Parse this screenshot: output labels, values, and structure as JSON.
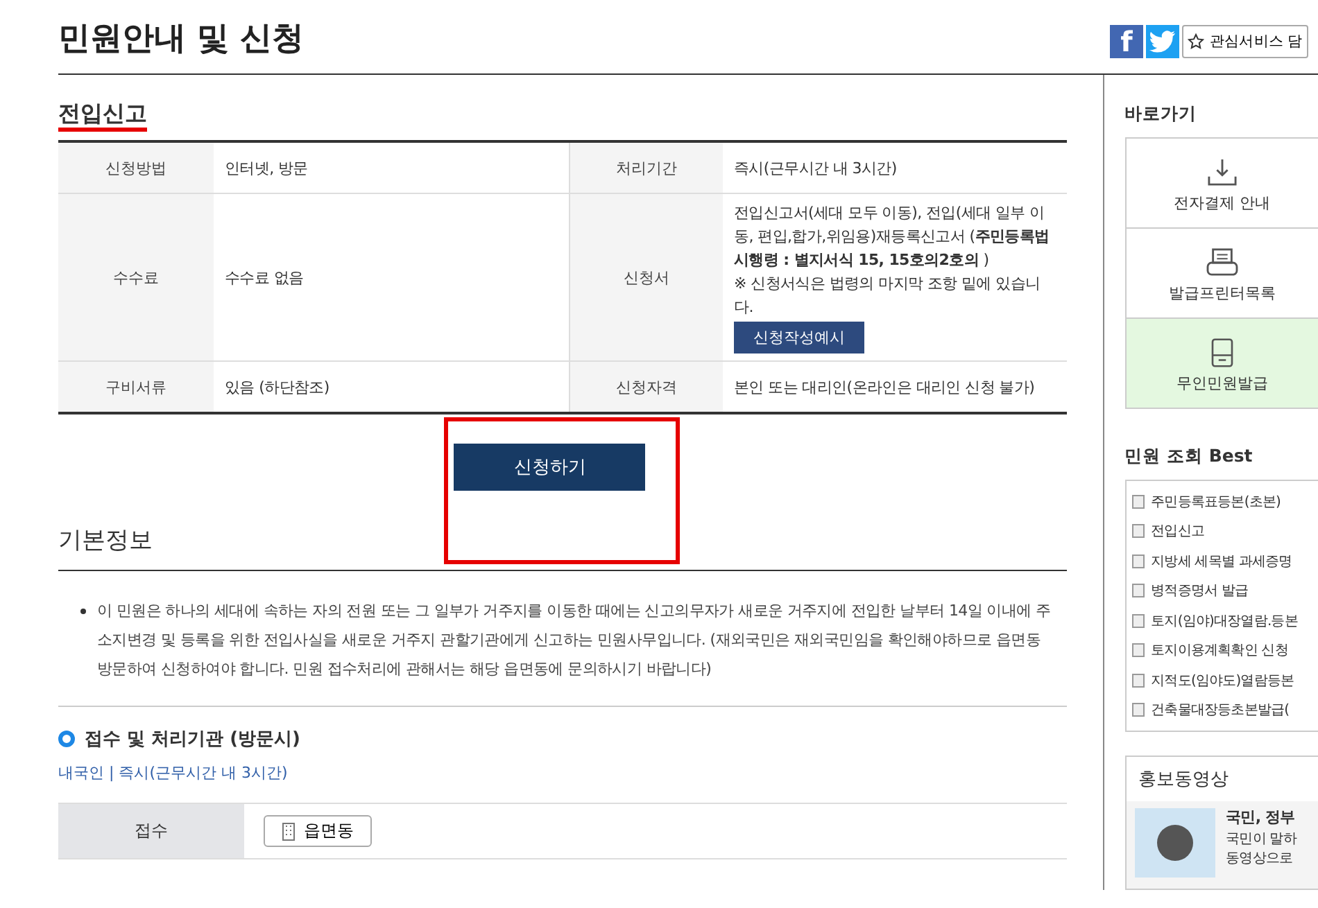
{
  "page_title": "민원안내 및 신청",
  "share": {
    "facebook": "f",
    "favorite": "관심서비스 담"
  },
  "section": {
    "title": "전입신고",
    "rows": [
      {
        "cells": [
          {
            "label": "신청방법",
            "value": "인터넷, 방문"
          },
          {
            "label": "처리기간",
            "value": "즉시(근무시간 내 3시간)"
          }
        ]
      },
      {
        "cells": [
          {
            "label": "수수료",
            "value": "수수료 없음"
          },
          {
            "label": "신청서",
            "value": "전입신고서(세대 모두 이동), 전입(세대 일부 이동, 편입,합가,위임용)재등록신고서 (**주민등록법 시행령 : 별지서식 15, 15호의2호의** )",
            "note": "※ 신청서식은 법령의 마지막 조항 밑에 있습니다.",
            "button": "신청작성예시"
          }
        ]
      },
      {
        "cells": [
          {
            "label": "구비서류",
            "value": "있음 (하단참조)"
          },
          {
            "label": "신청자격",
            "value": "본인 또는 대리인(온라인은 대리인 신청 불가)"
          }
        ]
      }
    ],
    "apply_button": "신청하기"
  },
  "basic_info": {
    "title": "기본정보",
    "text": "이 민원은 하나의 세대에 속하는 자의 전원 또는 그 일부가 거주지를 이동한 때에는 신고의무자가 새로운 거주지에 전입한 날부터 14일 이내에 주소지변경 및 등록을 위한 전입사실을 새로운 거주지 관할기관에게 신고하는 민원사무입니다. (재외국민은 재외국민임을 확인해야하므로 읍면동 방문하여 신청하여야 합니다. 민원 접수처리에 관해서는 해당 읍면동에 문의하시기 바랍니다)"
  },
  "agency": {
    "title": "접수 및 처리기관 (방문시)",
    "meta": "내국인 | 즉시(근무시간 내 3시간)",
    "rows": [
      {
        "label": "접수",
        "button": "읍면동"
      }
    ]
  },
  "sidebar": {
    "shortcuts_title": "바로가기",
    "shortcuts": [
      {
        "kind": "download",
        "label": "전자결제 안내",
        "selected": false
      },
      {
        "kind": "printer",
        "label": "발급프린터목록",
        "selected": false
      },
      {
        "kind": "kiosk",
        "label": "무인민원발급",
        "selected": true
      }
    ],
    "best_title": "민원 조회 Best",
    "best": [
      "주민등록표등본(초본)",
      "전입신고",
      "지방세 세목별 과세증명",
      "병적증명서 발급",
      "토지(임야)대장열람.등본",
      "토지이용계획확인 신청",
      "지적도(임야도)열람등본",
      "건축물대장등초본발급("
    ],
    "video_title": "홍보동영상",
    "video": {
      "title": "국민, 정부",
      "lines": [
        "국민이 말하",
        "동영상으로"
      ]
    }
  }
}
